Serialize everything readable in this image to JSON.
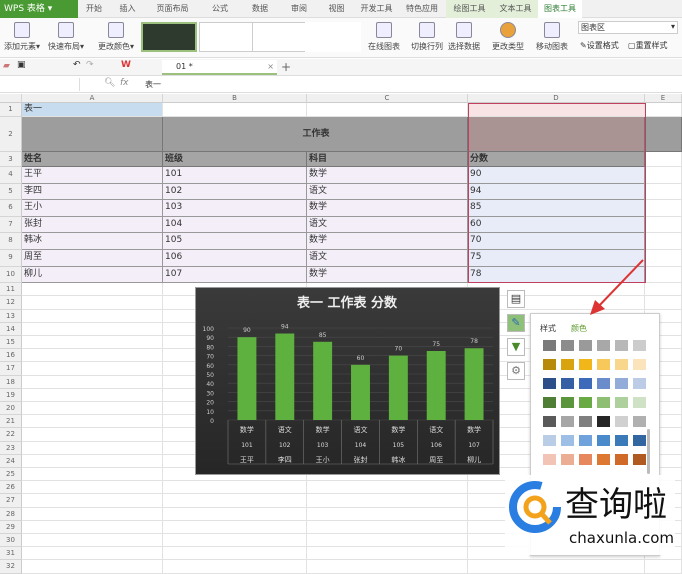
{
  "app": {
    "name": "WPS 表格"
  },
  "tabs": [
    "开始",
    "插入",
    "页面布局",
    "公式",
    "数据",
    "审阅",
    "视图",
    "开发工具",
    "特色应用",
    "绘图工具",
    "文本工具",
    "图表工具"
  ],
  "ribbon": {
    "add_element": "添加元素",
    "quick_layout": "快速布局",
    "change_color": "更改颜色",
    "online_chart": "在线图表",
    "switch_rowcol": "切换行列",
    "select_data": "选择数据",
    "change_type": "更改类型",
    "move_chart": "移动图表",
    "chart_area_select": "图表区",
    "set_format": "设置格式",
    "reset_style": "重置样式"
  },
  "doc_tab": "01 *",
  "formula": {
    "fx": "fx",
    "value": "表一"
  },
  "columns": [
    "A",
    "B",
    "C",
    "D",
    "E"
  ],
  "sheet": {
    "a1": "表一",
    "title": "工作表",
    "headers": [
      "姓名",
      "班级",
      "科目",
      "分数"
    ],
    "rows": [
      [
        "王平",
        "101",
        "数学",
        "90"
      ],
      [
        "李四",
        "102",
        "语文",
        "94"
      ],
      [
        "王小",
        "103",
        "数学",
        "85"
      ],
      [
        "张封",
        "104",
        "语文",
        "60"
      ],
      [
        "韩冰",
        "105",
        "数学",
        "70"
      ],
      [
        "周至",
        "106",
        "语文",
        "75"
      ],
      [
        "柳儿",
        "107",
        "数学",
        "78"
      ]
    ]
  },
  "chart_data": {
    "type": "bar",
    "title": "表一 工作表 分数",
    "categories": [
      [
        "数学",
        "101",
        "王平"
      ],
      [
        "语文",
        "102",
        "李四"
      ],
      [
        "数学",
        "103",
        "王小"
      ],
      [
        "语文",
        "104",
        "张封"
      ],
      [
        "数学",
        "105",
        "韩冰"
      ],
      [
        "语文",
        "106",
        "周至"
      ],
      [
        "数学",
        "107",
        "柳儿"
      ]
    ],
    "values": [
      90,
      94,
      85,
      60,
      70,
      75,
      78
    ],
    "yticks": [
      "0",
      "10",
      "20",
      "30",
      "40",
      "50",
      "60",
      "70",
      "80",
      "90",
      "100"
    ],
    "ylim": [
      0,
      100
    ],
    "bar_color": "#5fb13f"
  },
  "panel": {
    "tab_style": "样式",
    "tab_color": "颜色",
    "swatches": [
      [
        "#7a7a7a",
        "#8c8c8c",
        "#9a9a9a",
        "#a8a8a8",
        "#b8b8b8",
        "#cccccc"
      ],
      [
        "#b88a0c",
        "#d9a20f",
        "#f1b71a",
        "#f6c95a",
        "#f8d68b",
        "#fbe3bb"
      ],
      [
        "#2c4f8a",
        "#355fa5",
        "#3d6bb9",
        "#6a8ccb",
        "#93abd8",
        "#bccbe6"
      ],
      [
        "#4f7f34",
        "#5c963c",
        "#69aa45",
        "#8dbe72",
        "#aed09c",
        "#cfe2c5"
      ],
      [
        "#5a5a5a",
        "#a6a6a6",
        "#7f7f7f",
        "#262626",
        "#d0d0d0",
        "#b0b0b0"
      ],
      [
        "#b9cde6",
        "#9ebfe5",
        "#6fa2dc",
        "#4a8acb",
        "#3a7ab8",
        "#3166a0"
      ],
      [
        "#f2c4b6",
        "#ecad95",
        "#e6875e",
        "#dd7832",
        "#cf6a28",
        "#b05a22"
      ]
    ]
  },
  "watermark": {
    "name": "查询啦",
    "url": "chaxunla.com"
  }
}
